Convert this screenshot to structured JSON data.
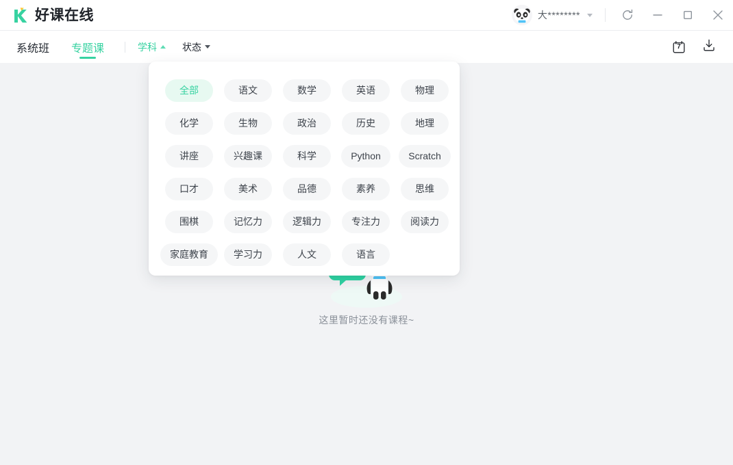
{
  "app": {
    "brand_name": "好课在线",
    "logo_icon": "k-logo-icon",
    "accent_color": "#37d2a1",
    "accent_soft_color": "#e7f9f1",
    "page_background": "#f2f3f5",
    "panel_background": "#ffffff"
  },
  "titlebar": {
    "avatar_icon": "panda-avatar-icon",
    "username": "大********",
    "user_caret_icon": "chevron-down-icon",
    "window_controls": [
      {
        "name": "refresh-button",
        "icon": "refresh-icon"
      },
      {
        "name": "minimize-button",
        "icon": "minimize-icon"
      },
      {
        "name": "maximize-button",
        "icon": "maximize-icon"
      },
      {
        "name": "close-button",
        "icon": "close-icon"
      }
    ]
  },
  "nav": {
    "tabs": [
      {
        "label": "系统班",
        "active": false
      },
      {
        "label": "专题课",
        "active": true
      }
    ],
    "filters": [
      {
        "label": "学科",
        "state": "open",
        "caret": "caret-up-icon"
      },
      {
        "label": "状态",
        "state": "closed",
        "caret": "caret-down-icon"
      }
    ],
    "actions": [
      {
        "name": "calendar-button",
        "icon": "calendar-icon",
        "badge": "7"
      },
      {
        "name": "download-button",
        "icon": "download-icon"
      }
    ]
  },
  "subject_dropdown": {
    "visible": true,
    "selected": "全部",
    "tags": [
      "全部",
      "语文",
      "数学",
      "英语",
      "物理",
      "化学",
      "生物",
      "政治",
      "历史",
      "地理",
      "讲座",
      "兴趣课",
      "科学",
      "Python",
      "Scratch",
      "口才",
      "美术",
      "品德",
      "素养",
      "思维",
      "围棋",
      "记忆力",
      "逻辑力",
      "专注力",
      "阅读力",
      "家庭教育",
      "学习力",
      "人文",
      "语言"
    ]
  },
  "empty_state": {
    "illustration": "panda-empty-illustration",
    "message": "这里暂时还没有课程~"
  }
}
